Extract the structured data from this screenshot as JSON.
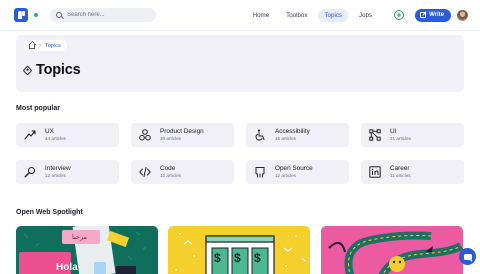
{
  "search": {
    "placeholder": "Search here..."
  },
  "nav": {
    "links": [
      {
        "label": "Home"
      },
      {
        "label": "Toolbox"
      },
      {
        "label": "Topics"
      },
      {
        "label": "Jobs"
      }
    ],
    "write_label": "Write"
  },
  "breadcrumb": {
    "current": "Topics"
  },
  "page": {
    "title": "Topics"
  },
  "most_popular": {
    "heading": "Most popular",
    "items": [
      {
        "name": "UX",
        "count": "44 articles",
        "icon": "trend-arrow-icon"
      },
      {
        "name": "Product Design",
        "count": "30 articles",
        "icon": "shapes-icon"
      },
      {
        "name": "Accessibility",
        "count": "15 articles",
        "icon": "wheelchair-icon"
      },
      {
        "name": "UI",
        "count": "21 articles",
        "icon": "nodes-icon"
      },
      {
        "name": "Interview",
        "count": "12 articles",
        "icon": "microphone-icon"
      },
      {
        "name": "Code",
        "count": "12 articles",
        "icon": "code-icon"
      },
      {
        "name": "Open Source",
        "count": "12 articles",
        "icon": "open-source-icon"
      },
      {
        "name": "Career",
        "count": "11 articles",
        "icon": "linkedin-icon"
      }
    ]
  },
  "spotlight": {
    "heading": "Open Web Spotlight",
    "cards": [
      {
        "greeting_top": "مرحبا",
        "greeting_main": "Hola",
        "color": "#0f6e5c"
      },
      {
        "color": "#f5cf2c",
        "symbol": "$"
      },
      {
        "color": "#ec5aa2"
      }
    ]
  },
  "colors": {
    "accent": "#2b5bd7",
    "card_bg": "#f0f0f6",
    "success": "#26a26a"
  }
}
